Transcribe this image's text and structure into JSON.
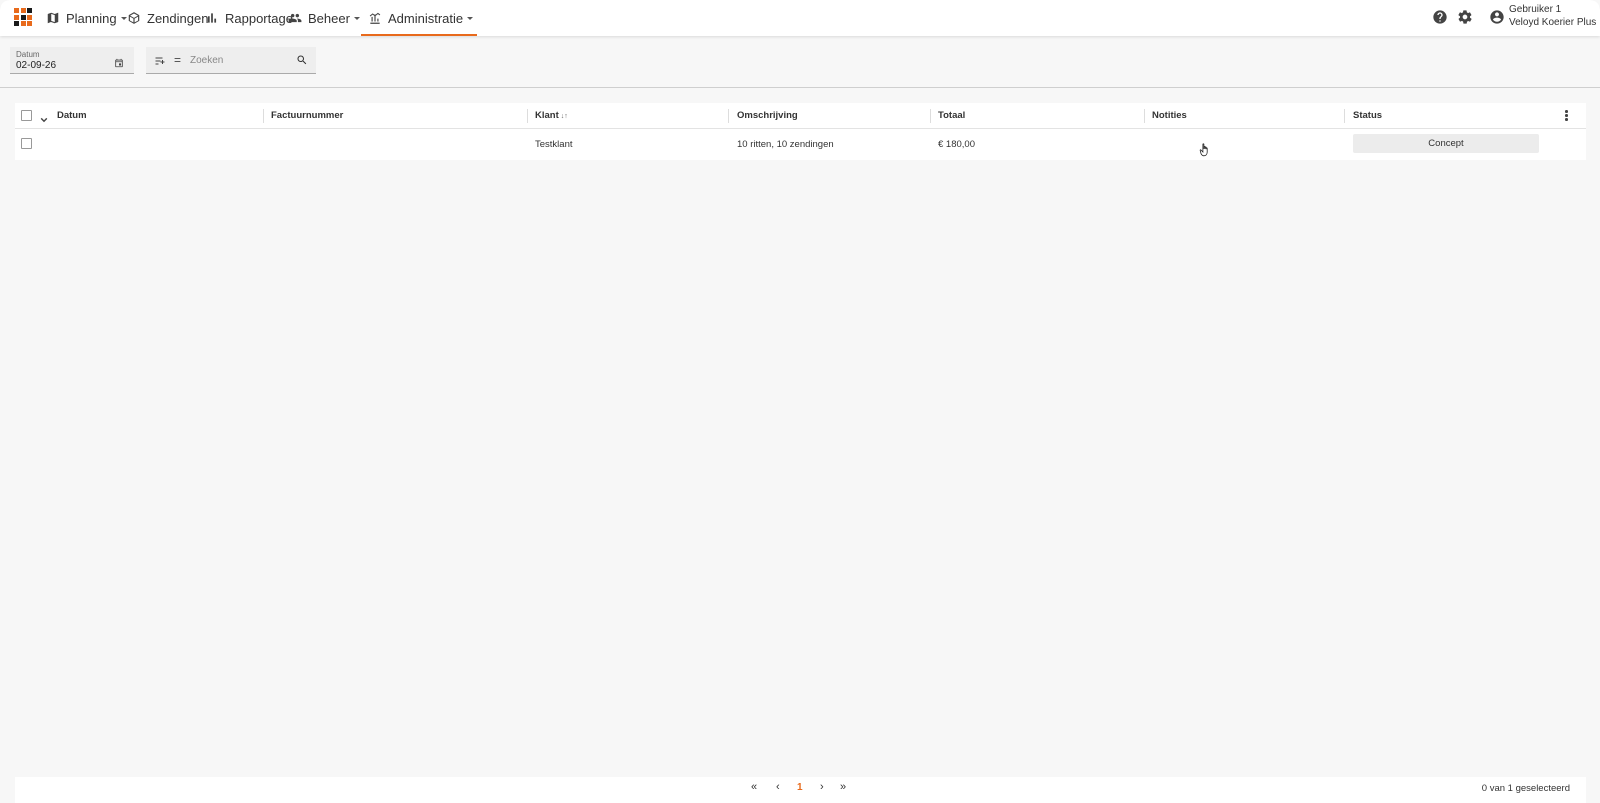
{
  "nav": {
    "items": [
      {
        "label": "Planning",
        "icon": "map-icon",
        "dropdown": true
      },
      {
        "label": "Zendingen",
        "icon": "package-icon",
        "dropdown": false
      },
      {
        "label": "Rapportage",
        "icon": "bar-chart-icon",
        "dropdown": false
      },
      {
        "label": "Beheer",
        "icon": "group-icon",
        "dropdown": true
      },
      {
        "label": "Administratie",
        "icon": "chart-admin-icon",
        "dropdown": true,
        "active": true
      }
    ]
  },
  "user": {
    "name": "Gebruiker 1",
    "company": "Veloyd Koerier Plus"
  },
  "toolbar": {
    "date_label": "Datum",
    "date_value": "02-09-26",
    "search_placeholder": "Zoeken",
    "operator": "="
  },
  "table": {
    "columns": [
      "Datum",
      "Factuurnummer",
      "Klant",
      "Omschrijving",
      "Totaal",
      "Notities",
      "Status"
    ],
    "rows": [
      {
        "datum": "",
        "factuurnummer": "",
        "klant": "Testklant",
        "omschrijving": "10 ritten, 10 zendingen",
        "totaal": "€ 180,00",
        "notities": "",
        "status": "Concept"
      }
    ]
  },
  "pagination": {
    "current_page": "1",
    "selected_text": "0 van 1 geselecteerd"
  },
  "colors": {
    "accent": "#e86a1c",
    "logo": [
      "#e86a1c",
      "#e86a1c",
      "#1a1a1a",
      "#e86a1c",
      "#1a1a1a",
      "#e86a1c",
      "#1a1a1a",
      "#e86a1c",
      "#e86a1c"
    ]
  }
}
